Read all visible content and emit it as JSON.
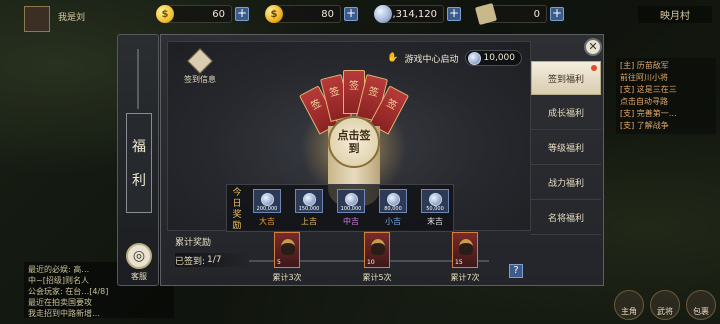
{
  "currencies": [
    {
      "value": "60",
      "icon": "gold-coin-icon",
      "color": "#f2c230"
    },
    {
      "value": "80",
      "icon": "bound-gold-icon",
      "color": "#f0b020"
    },
    {
      "value": "2,314,120",
      "icon": "silver-coin-icon",
      "color": "#9fb3d6"
    },
    {
      "value": "0",
      "icon": "scroll-token-icon",
      "color": "#c9b98a"
    }
  ],
  "hud": {
    "player_name": "我是刘",
    "map_name": "映月村",
    "chat_lines": [
      "最近的必娱: 高…",
      "中~[招级]则名人",
      "公会玩家: 在台…[4/8]",
      "最近在拍卖国要攻",
      "我走招到中路新增…"
    ],
    "quests": [
      "[主] 历苗敌军",
      "前往阿川小将",
      "[支] 这是三在三",
      "点击自动寻路",
      "[支] 完善第一…",
      "[支] 了解战争"
    ],
    "bottom_buttons": [
      "主角",
      "武将",
      "包裹"
    ]
  },
  "nav": {
    "fuli_chars": [
      "福",
      "利"
    ],
    "kefu_label": "客服"
  },
  "panel": {
    "sign_info": "签到信息",
    "launch_label": "游戏中心启动",
    "launch_amount": "10,000",
    "stick_char": "签",
    "seal_text": "点击签到",
    "today_title": "今日奖励",
    "prizes": [
      {
        "amount": "200,000",
        "label": "大吉",
        "color": "#e8a030"
      },
      {
        "amount": "150,000",
        "label": "上吉",
        "color": "#e8c25a"
      },
      {
        "amount": "100,000",
        "label": "中吉",
        "color": "#d080e0"
      },
      {
        "amount": "80,000",
        "label": "小吉",
        "color": "#7ab0f0"
      },
      {
        "amount": "50,000",
        "label": "末吉",
        "color": "#e8e8e8"
      }
    ],
    "cum_title": "累计奖励",
    "signed_label": "已签到:",
    "signed_value": "1/7",
    "milestones": [
      {
        "count": "5",
        "label": "累计3次"
      },
      {
        "count": "10",
        "label": "累计5次"
      },
      {
        "count": "15",
        "label": "累计7次"
      }
    ],
    "help": "?"
  },
  "tabs": [
    {
      "label": "签到福利",
      "active": true
    },
    {
      "label": "成长福利",
      "active": false
    },
    {
      "label": "等级福利",
      "active": false
    },
    {
      "label": "战力福利",
      "active": false
    },
    {
      "label": "名将福利",
      "active": false
    }
  ]
}
